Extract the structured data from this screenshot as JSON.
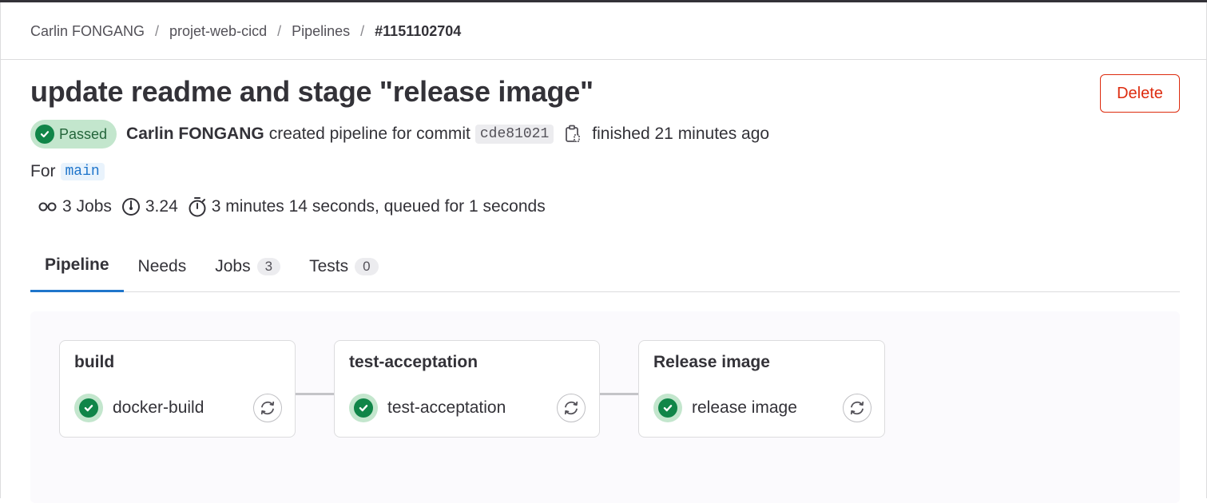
{
  "breadcrumb": {
    "items": [
      "Carlin FONGANG",
      "projet-web-cicd",
      "Pipelines"
    ],
    "current": "#1151102704",
    "separator": "/"
  },
  "pipeline": {
    "title": "update readme and stage \"release image\"",
    "delete_label": "Delete",
    "status": "Passed",
    "author": "Carlin FONGANG",
    "created_text": "created pipeline for commit",
    "commit": "cde81021",
    "finished_text": "finished 21 minutes ago",
    "for_label": "For",
    "branch": "main"
  },
  "stats": {
    "jobs": "3 Jobs",
    "compute": "3.24",
    "duration": "3 minutes 14 seconds, queued for 1 seconds"
  },
  "tabs": [
    {
      "label": "Pipeline"
    },
    {
      "label": "Needs"
    },
    {
      "label": "Jobs",
      "count": "3"
    },
    {
      "label": "Tests",
      "count": "0"
    }
  ],
  "stages": [
    {
      "name": "build",
      "job": "docker-build"
    },
    {
      "name": "test-acceptation",
      "job": "test-acceptation"
    },
    {
      "name": "Release image",
      "job": "release image"
    }
  ],
  "colors": {
    "success": "#108548",
    "success_bg": "#c3e6cd",
    "danger": "#dd2b0e",
    "link": "#1f75cb"
  }
}
